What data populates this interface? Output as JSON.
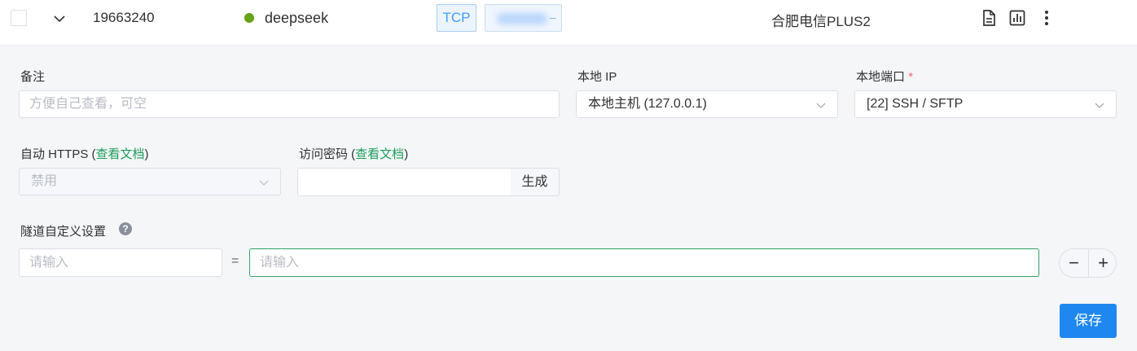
{
  "row": {
    "tunnel_id": "19663240",
    "tunnel_name": "deepseek",
    "status_color": "#67a316",
    "protocol_tag": "TCP",
    "node_name": "合肥电信PLUS2",
    "actions": [
      "document-icon",
      "chart-icon",
      "more-vertical-icon"
    ]
  },
  "form": {
    "remark": {
      "label": "备注",
      "placeholder": "方便自己查看，可空",
      "value": ""
    },
    "local_ip": {
      "label": "本地 IP",
      "value": "本地主机 (127.0.0.1)"
    },
    "local_port": {
      "label": "本地端口",
      "required_mark": "*",
      "value": "[22] SSH / SFTP"
    },
    "auto_https": {
      "label": "自动 HTTPS (",
      "link": "查看文档",
      "label_end": ")",
      "value": "禁用"
    },
    "access_password": {
      "label": "访问密码 (",
      "link": "查看文档",
      "label_end": ")",
      "value": "",
      "generate_label": "生成"
    },
    "custom_settings": {
      "label": "隧道自定义设置",
      "help_icon": "?",
      "key_placeholder": "请输入",
      "equals": "=",
      "value_placeholder": "请输入",
      "remove_label": "−",
      "add_label": "+"
    },
    "save_label": "保存"
  },
  "colors": {
    "accent_green": "#1a9c5a",
    "primary_blue": "#1e88f0",
    "tag_blue": "#409eff"
  }
}
